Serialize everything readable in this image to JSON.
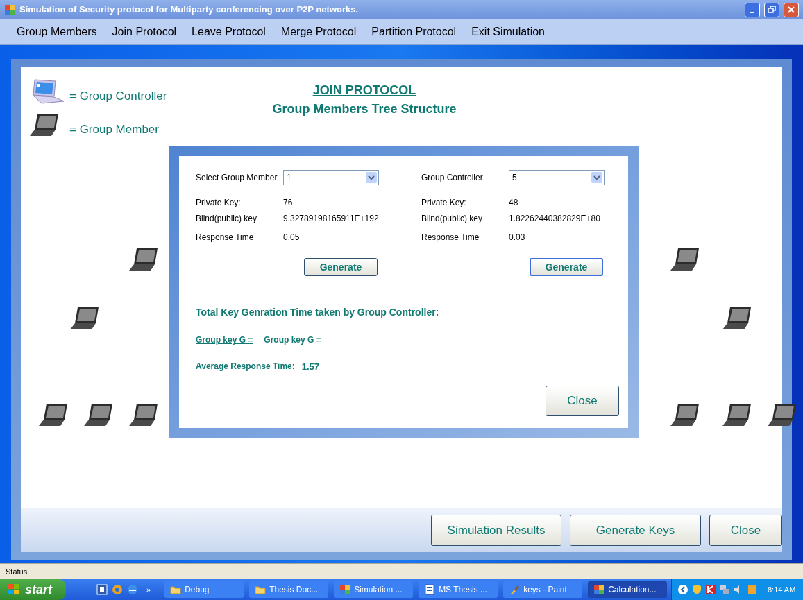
{
  "window": {
    "title": "Simulation of Security protocol for Multiparty conferencing over P2P networks."
  },
  "menu": [
    "Group Members",
    "Join Protocol",
    "Leave Protocol",
    "Merge Protocol",
    "Partition Protocol",
    "Exit Simulation"
  ],
  "legend": [
    {
      "kind": "controller",
      "label": "= Group Controller"
    },
    {
      "kind": "member",
      "label": "= Group Member"
    }
  ],
  "heading": [
    "JOIN PROTOCOL",
    "Group Members Tree Structure"
  ],
  "dialog": {
    "panels": [
      {
        "select_label": "Select Group Member",
        "select_value": "1",
        "rows": [
          {
            "label": "Private Key:",
            "value": "76"
          },
          {
            "label": "Blind(public) key",
            "value": "9.32789198165911E+192"
          },
          {
            "label": "Response Time",
            "value": "0.05"
          }
        ],
        "button": {
          "label": "Generate",
          "focused": false
        }
      },
      {
        "select_label": "Group Controller",
        "select_value": "5",
        "rows": [
          {
            "label": "Private Key:",
            "value": "48"
          },
          {
            "label": "Blind(public) key",
            "value": "1.82262440382829E+80"
          },
          {
            "label": "Response Time",
            "value": "0.03"
          }
        ],
        "button": {
          "label": "Generate",
          "focused": true
        }
      }
    ],
    "total_label": "Total Key Genration Time taken by Group Controller:",
    "group_key": {
      "label": "Group key G =",
      "value": "Group key G ="
    },
    "average": {
      "label": "Average Response Time:",
      "value": "1.57"
    },
    "close": "Close"
  },
  "buttons": [
    {
      "label": "Simulation Results",
      "underlined": true
    },
    {
      "label": "Generate Keys",
      "underlined": true
    },
    {
      "label": "Close",
      "underlined": false
    }
  ],
  "status_bar": "Status",
  "taskbar": {
    "start": "start",
    "more": "»",
    "tasks": [
      {
        "label": "Debug",
        "kind": "folder",
        "selected": false
      },
      {
        "label": "Thesis Doc...",
        "kind": "folder",
        "selected": false
      },
      {
        "label": "Simulation ...",
        "kind": "app",
        "selected": false
      },
      {
        "label": "MS Thesis ...",
        "kind": "doc",
        "selected": false
      },
      {
        "label": "keys - Paint",
        "kind": "paint",
        "selected": false
      },
      {
        "label": "Calculation...",
        "kind": "app",
        "selected": true
      }
    ],
    "clock": "8:14 AM"
  }
}
